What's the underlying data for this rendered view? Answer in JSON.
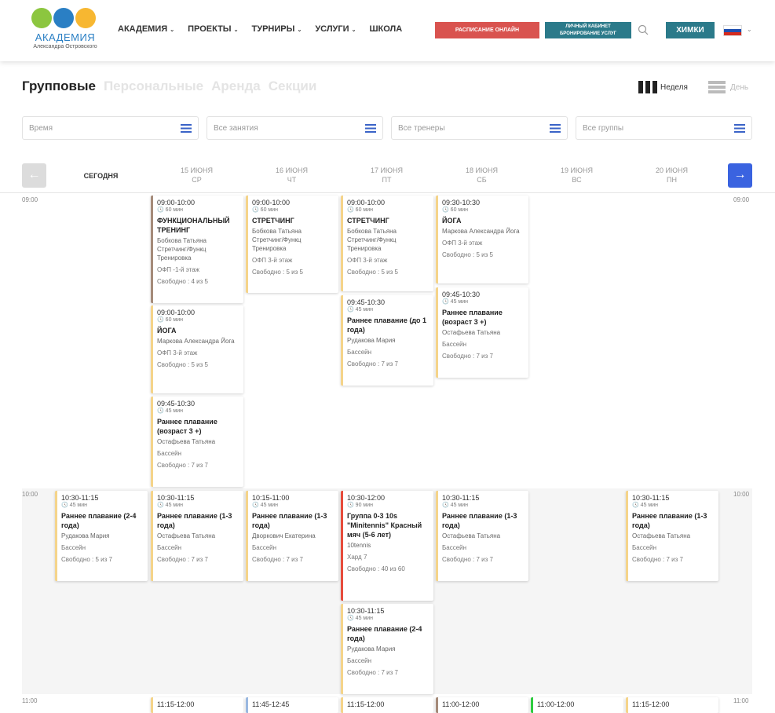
{
  "header": {
    "logo": {
      "title": "АКАДЕМИЯ",
      "subtitle": "Александра Островского"
    },
    "nav": [
      {
        "label": "АКАДЕМИЯ",
        "dropdown": true
      },
      {
        "label": "ПРОЕКТЫ",
        "dropdown": true
      },
      {
        "label": "ТУРНИРЫ",
        "dropdown": true
      },
      {
        "label": "УСЛУГИ",
        "dropdown": true
      },
      {
        "label": "ШКОЛА",
        "dropdown": false
      }
    ],
    "schedule_button": "РАСПИСАНИЕ ОНЛАЙН",
    "cabinet_button_line1": "ЛИЧНЫЙ КАБИНЕТ",
    "cabinet_button_line2": "БРОНИРОВАНИЕ УСЛУГ",
    "city_button": "ХИМКИ",
    "colors": {
      "red": "#d9534f",
      "teal": "#2b7a8a"
    }
  },
  "tabs": [
    "Групповые",
    "Персональные",
    "Аренда",
    "Секции"
  ],
  "view": {
    "week": "Неделя",
    "day": "День"
  },
  "filters": [
    "Время",
    "Все занятия",
    "Все тренеры",
    "Все группы"
  ],
  "days": [
    {
      "date": "СЕГОДНЯ",
      "dow": ""
    },
    {
      "date": "15 ИЮНЯ",
      "dow": "СР"
    },
    {
      "date": "16 ИЮНЯ",
      "dow": "ЧТ"
    },
    {
      "date": "17 ИЮНЯ",
      "dow": "ПТ"
    },
    {
      "date": "18 ИЮНЯ",
      "dow": "СБ"
    },
    {
      "date": "19 ИЮНЯ",
      "dow": "ВС"
    },
    {
      "date": "20 ИЮНЯ",
      "dow": "ПН"
    }
  ],
  "hours": [
    "09:00",
    "10:00",
    "11:00"
  ],
  "cards": [
    {
      "time": "09:00-10:00",
      "dur": "60 мин",
      "name": "ФУНКЦИОНАЛЬНЫЙ ТРЕНИНГ",
      "coach": "Бобкова Татьяна Стретчинг/Функц Тренировка",
      "place": "ОФП -1-й этаж",
      "seats": "Свободно : 4 из 5"
    },
    {
      "time": "09:00-10:00",
      "dur": "60 мин",
      "name": "ЙОГА",
      "coach": "Маркова Александра Йога",
      "place": "ОФП 3-й этаж",
      "seats": "Свободно : 5 из 5"
    },
    {
      "time": "09:45-10:30",
      "dur": "45 мин",
      "name": "Раннее плавание (возраст 3 +)",
      "coach": "Остафьева Татьяна",
      "place": "Бассейн",
      "seats": "Свободно : 7 из 7"
    },
    {
      "time": "09:00-10:00",
      "dur": "60 мин",
      "name": "СТРЕТЧИНГ",
      "coach": "Бобкова Татьяна Стретчинг/Функц Тренировка",
      "place": "ОФП 3-й этаж",
      "seats": "Свободно : 5 из 5"
    },
    {
      "time": "09:00-10:00",
      "dur": "60 мин",
      "name": "СТРЕТЧИНГ",
      "coach": "Бобкова Татьяна Стретчинг/Функц Тренировка",
      "place": "ОФП 3-й этаж",
      "seats": "Свободно : 5 из 5"
    },
    {
      "time": "09:45-10:30",
      "dur": "45 мин",
      "name": "Раннее плавание (до 1 года)",
      "coach": "Рудакова Мария",
      "place": "Бассейн",
      "seats": "Свободно : 7 из 7"
    },
    {
      "time": "09:30-10:30",
      "dur": "60 мин",
      "name": "ЙОГА",
      "coach": "Маркова Александра Йога",
      "place": "ОФП 3-й этаж",
      "seats": "Свободно : 5 из 5"
    },
    {
      "time": "09:45-10:30",
      "dur": "45 мин",
      "name": "Раннее плавание (возраст 3 +)",
      "coach": "Остафьева Татьяна",
      "place": "Бассейн",
      "seats": "Свободно : 7 из 7"
    },
    {
      "time": "10:30-11:15",
      "dur": "45 мин",
      "name": "Раннее плавание (2-4 года)",
      "coach": "Рудакова Мария",
      "place": "Бассейн",
      "seats": "Свободно : 5 из 7"
    },
    {
      "time": "10:30-11:15",
      "dur": "45 мин",
      "name": "Раннее плавание (1-3 года)",
      "coach": "Остафьева Татьяна",
      "place": "Бассейн",
      "seats": "Свободно : 7 из 7"
    },
    {
      "time": "10:15-11:00",
      "dur": "45 мин",
      "name": "Раннее плавание (1-3 года)",
      "coach": "Дворкович Екатерина",
      "place": "Бассейн",
      "seats": "Свободно : 7 из 7"
    },
    {
      "time": "10:30-12:00",
      "dur": "90 мин",
      "name": "Группа 0-3 10s \"Minitennis\" Красный мяч (5-6 лет)",
      "coach": "10tennis",
      "place": "Хард 7",
      "seats": "Свободно : 40 из 60"
    },
    {
      "time": "10:30-11:15",
      "dur": "45 мин",
      "name": "Раннее плавание (2-4 года)",
      "coach": "Рудакова Мария",
      "place": "Бассейн",
      "seats": "Свободно : 7 из 7"
    },
    {
      "time": "10:30-11:15",
      "dur": "45 мин",
      "name": "Раннее плавание (1-3 года)",
      "coach": "Остафьева Татьяна",
      "place": "Бассейн",
      "seats": "Свободно : 7 из 7"
    },
    {
      "time": "10:30-11:15",
      "dur": "45 мин",
      "name": "Раннее плавание (1-3 года)",
      "coach": "Остафьева Татьяна",
      "place": "Бассейн",
      "seats": "Свободно : 7 из 7"
    },
    {
      "time": "11:15-12:00",
      "dur": "",
      "name": "",
      "coach": "",
      "place": "",
      "seats": ""
    },
    {
      "time": "11:45-12:45",
      "dur": "",
      "name": "",
      "coach": "",
      "place": "",
      "seats": ""
    },
    {
      "time": "11:15-12:00",
      "dur": "",
      "name": "",
      "coach": "",
      "place": "",
      "seats": ""
    },
    {
      "time": "11:00-12:00",
      "dur": "",
      "name": "",
      "coach": "",
      "place": "",
      "seats": ""
    },
    {
      "time": "11:00-12:00",
      "dur": "",
      "name": "",
      "coach": "",
      "place": "",
      "seats": ""
    },
    {
      "time": "11:15-12:00",
      "dur": "",
      "name": "",
      "coach": "",
      "place": "",
      "seats": ""
    }
  ]
}
